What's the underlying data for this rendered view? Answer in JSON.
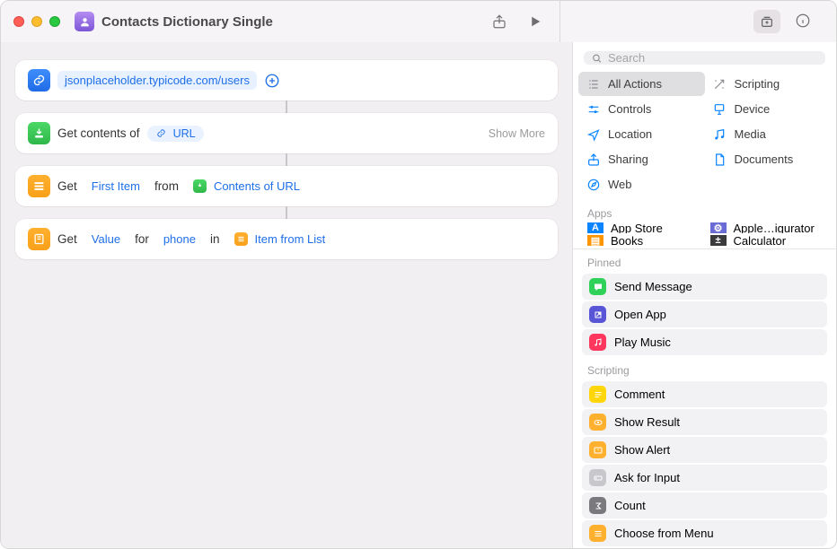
{
  "title": "Contacts Dictionary Single",
  "search": {
    "placeholder": "Search"
  },
  "categories": [
    {
      "id": "all",
      "label": "All Actions",
      "selected": true,
      "color": "#8e8e93",
      "icon": "list"
    },
    {
      "id": "scripting",
      "label": "Scripting",
      "selected": false,
      "color": "#8e8e93",
      "icon": "wand"
    },
    {
      "id": "controls",
      "label": "Controls",
      "selected": false,
      "color": "#0b84ff",
      "icon": "slider"
    },
    {
      "id": "device",
      "label": "Device",
      "selected": false,
      "color": "#0b84ff",
      "icon": "device"
    },
    {
      "id": "location",
      "label": "Location",
      "selected": false,
      "color": "#0b84ff",
      "icon": "nav"
    },
    {
      "id": "media",
      "label": "Media",
      "selected": false,
      "color": "#0b84ff",
      "icon": "music"
    },
    {
      "id": "sharing",
      "label": "Sharing",
      "selected": false,
      "color": "#0b84ff",
      "icon": "share"
    },
    {
      "id": "documents",
      "label": "Documents",
      "selected": false,
      "color": "#0b84ff",
      "icon": "doc"
    },
    {
      "id": "web",
      "label": "Web",
      "selected": false,
      "color": "#0b84ff",
      "icon": "safari"
    }
  ],
  "apps_header": "Apps",
  "apps": [
    {
      "label": "App Store",
      "color": "#0a84ff",
      "glyph": "A"
    },
    {
      "label": "Apple…igurator",
      "color": "#6b6bd6",
      "glyph": "⚙"
    },
    {
      "label": "Books",
      "color": "#ff9500",
      "glyph": "▤"
    },
    {
      "label": "Calculator",
      "color": "#3a3a3c",
      "glyph": "±"
    }
  ],
  "pinned_header": "Pinned",
  "pinned": [
    {
      "label": "Send Message",
      "bg": "#30d158",
      "icon": "msg"
    },
    {
      "label": "Open App",
      "bg": "#5856d6",
      "icon": "open"
    },
    {
      "label": "Play Music",
      "bg": "#ff375f",
      "icon": "music"
    }
  ],
  "scripting_header": "Scripting",
  "scripting": [
    {
      "label": "Comment",
      "bg": "#ffd60a",
      "icon": "lines"
    },
    {
      "label": "Show Result",
      "bg": "#ffb02e",
      "icon": "eye"
    },
    {
      "label": "Show Alert",
      "bg": "#ffb02e",
      "icon": "alert"
    },
    {
      "label": "Ask for Input",
      "bg": "#c8c8cc",
      "icon": "input"
    },
    {
      "label": "Count",
      "bg": "#7a7a7e",
      "icon": "sigma"
    },
    {
      "label": "Choose from Menu",
      "bg": "#ffb02e",
      "icon": "menu"
    }
  ],
  "blocks": {
    "url_value": "jsonplaceholder.typicode.com/users",
    "get_contents": {
      "prefix": "Get contents of",
      "pill": "URL",
      "show_more": "Show More"
    },
    "get_item": {
      "w1": "Get",
      "var1": "First Item",
      "w2": "from",
      "var2": "Contents of URL"
    },
    "get_value": {
      "w1": "Get",
      "var1": "Value",
      "w2": "for",
      "var2": "phone",
      "w3": "in",
      "var3": "Item from List"
    }
  }
}
